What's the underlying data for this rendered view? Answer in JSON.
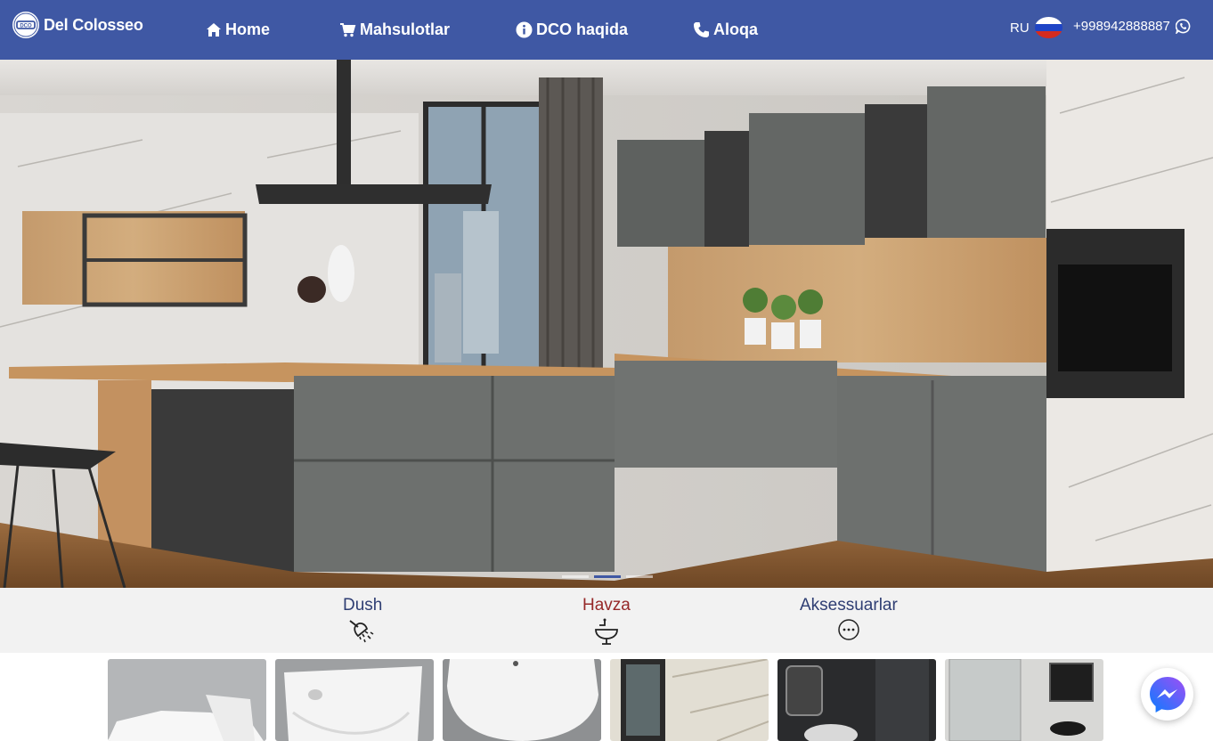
{
  "navbar": {
    "brand": "Del Colosseo",
    "links": {
      "home": "Home",
      "products": "Mahsulotlar",
      "about": "DCO haqida",
      "contact": "Aloqa"
    },
    "language": "RU",
    "phone": "+998942888887"
  },
  "hero": {
    "slide_count": 3,
    "active_slide": 2
  },
  "categories": {
    "dush": "Dush",
    "havza": "Havza",
    "aksessuarlar": "Aksessuarlar",
    "active": "Havza"
  },
  "colors": {
    "navbar": "#3f58a4",
    "active_category": "#962828",
    "category_text": "#2f3e73",
    "messenger": "#1877f2"
  },
  "icons": [
    "logo-icon",
    "home-icon",
    "cart-icon",
    "info-icon",
    "phone-icon",
    "whatsapp-icon",
    "shower-icon",
    "sink-icon",
    "more-icon",
    "messenger-icon"
  ]
}
